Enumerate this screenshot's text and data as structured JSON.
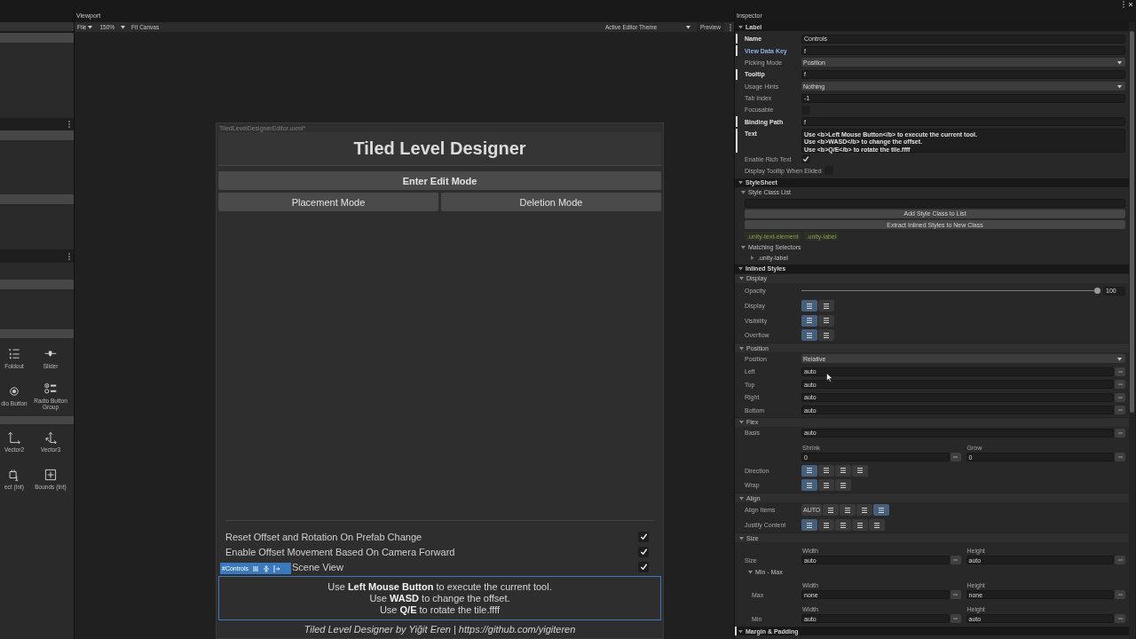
{
  "left_panel": {
    "library_items": [
      {
        "label": "Foldout"
      },
      {
        "label": "Slider"
      },
      {
        "label": "dio Button"
      },
      {
        "label": "Radio Button Group"
      },
      {
        "label": "Vector2"
      },
      {
        "label": "Vector3"
      },
      {
        "label": "ect (Int)"
      },
      {
        "label": "Bounds (Int)"
      }
    ]
  },
  "viewport": {
    "title": "Viewport",
    "toolbar": {
      "file_menu": "File",
      "zoom": "150%",
      "fit_button": "Fit Canvas",
      "theme": "Active Editor Theme",
      "preview_button": "Preview"
    },
    "document": {
      "file_name": "TiledLevelDesignerEditor.uxml*",
      "title": "Tiled Level Designer",
      "primary_button": "Enter Edit Mode",
      "mode_buttons": [
        {
          "label": "Placement Mode"
        },
        {
          "label": "Deletion Mode"
        }
      ],
      "toggles": [
        {
          "label": "Reset Offset and Rotation On Prefab Change",
          "checked": true
        },
        {
          "label": "Enable Offset Movement Based On Camera Forward",
          "checked": true
        },
        {
          "label": "Scene View",
          "checked": true
        }
      ],
      "controls": {
        "selected": true,
        "tag": "#Controls",
        "lines": [
          "Use **Left Mouse Button** to execute the current tool.",
          "Use **WASD** to change the offset.",
          "Use **Q/E** to rotate the tile.ffff"
        ]
      },
      "footer": "Tiled Level Designer by Yiğit Eren | https://github.com/yigiteren"
    }
  },
  "inspector": {
    "title": "Inspector",
    "sections": [
      {
        "title": "Label",
        "expanded": true,
        "overridden": false,
        "rows": [
          {
            "kind": "field",
            "label": "Name",
            "value": "Controls",
            "overridden": true,
            "focused": false
          },
          {
            "kind": "field",
            "label": "View Data Key",
            "value": "f",
            "overridden": true,
            "focused": true
          },
          {
            "kind": "dropdown",
            "label": "Picking Mode",
            "value": "Position",
            "overridden": false,
            "focused": false
          },
          {
            "kind": "field",
            "label": "Tooltip",
            "value": "f",
            "overridden": true,
            "focused": false
          },
          {
            "kind": "dropdown",
            "label": "Usage Hints",
            "value": "Nothing",
            "overridden": false,
            "focused": false
          },
          {
            "kind": "field",
            "label": "Tab Index",
            "value": "-1",
            "overridden": false,
            "focused": false
          },
          {
            "kind": "checkbox",
            "label": "Focusable",
            "checked": false,
            "overridden": false,
            "focused": false
          },
          {
            "kind": "field",
            "label": "Binding Path",
            "value": "f",
            "overridden": true,
            "focused": false
          },
          {
            "kind": "textarea",
            "label": "Text",
            "lines": [
              "Use <b>Left Mouse Button</b> to execute the current tool.",
              "Use <b>WASD</b> to change the offset.",
              "Use <b>Q/E</b> to rotate the tile.ffff"
            ],
            "overridden": true,
            "focused": false
          },
          {
            "kind": "checkbox",
            "label": "Enable Rich Text",
            "checked": true,
            "overridden": false,
            "focused": false
          },
          {
            "kind": "checkbox",
            "label": "Display Tooltip When Elided",
            "checked": false,
            "overridden": false,
            "focused": false
          }
        ]
      },
      {
        "title": "StyleSheet",
        "expanded": true,
        "overridden": false,
        "subsections": [
          {
            "kind": "foldout",
            "title": "Style Class List",
            "expanded": true,
            "rows": [
              {
                "kind": "input"
              },
              {
                "kind": "button",
                "label": "Add Style Class to List"
              },
              {
                "kind": "button",
                "label": "Extract Inlined Styles to New Class"
              },
              {
                "kind": "tags",
                "tags": [
                  {
                    "label": ".unity-text-element"
                  },
                  {
                    "label": ".unity-label"
                  }
                ]
              }
            ]
          },
          {
            "kind": "foldout",
            "title": "Matching Selectors",
            "expanded": true,
            "rows": [
              {
                "kind": "tree-item",
                "label": ".unity-label",
                "expanded": false
              }
            ]
          }
        ]
      },
      {
        "title": "Inlined Styles",
        "expanded": true,
        "overridden": false,
        "subsections": [
          {
            "kind": "bar",
            "title": "Display",
            "expanded": true,
            "rows": [
              {
                "kind": "slider",
                "label": "Opacity",
                "level": 1,
                "reading": "100"
              },
              {
                "kind": "toggles",
                "label": "Display",
                "options": [
                  {
                    "selected": true
                  },
                  {
                    "selected": false
                  }
                ]
              },
              {
                "kind": "toggles",
                "label": "Visibility",
                "options": [
                  {
                    "selected": true
                  },
                  {
                    "selected": false
                  }
                ]
              },
              {
                "kind": "toggles",
                "label": "Overflow",
                "options": [
                  {
                    "selected": true
                  },
                  {
                    "selected": false
                  }
                ]
              }
            ]
          },
          {
            "kind": "bar",
            "title": "Position",
            "expanded": true,
            "rows": [
              {
                "kind": "dropdown",
                "label": "Position",
                "value": "Relative"
              },
              {
                "kind": "unit-field",
                "label": "Left",
                "value": "auto"
              },
              {
                "kind": "unit-field",
                "label": "Top",
                "value": "auto"
              },
              {
                "kind": "unit-field",
                "label": "Right",
                "value": "auto"
              },
              {
                "kind": "unit-field",
                "label": "Bottom",
                "value": "auto"
              }
            ]
          },
          {
            "kind": "bar",
            "title": "Flex",
            "expanded": true,
            "rows": [
              {
                "kind": "unit-field",
                "label": "Basis",
                "value": "auto"
              },
              {
                "kind": "pair",
                "items": [
                  {
                    "heading": "Shrink",
                    "value": "0"
                  },
                  {
                    "heading": "Grow",
                    "value": "0"
                  }
                ]
              },
              {
                "kind": "toggles",
                "label": "Direction",
                "options": [
                  {
                    "selected": true
                  },
                  {
                    "selected": false
                  },
                  {
                    "selected": false
                  },
                  {
                    "selected": false
                  }
                ]
              },
              {
                "kind": "toggles",
                "label": "Wrap",
                "options": [
                  {
                    "selected": true
                  },
                  {
                    "selected": false
                  },
                  {
                    "selected": false
                  }
                ]
              }
            ]
          },
          {
            "kind": "bar",
            "title": "Align",
            "expanded": true,
            "rows": [
              {
                "kind": "toggles",
                "label": "Align Items",
                "options": [
                  {
                    "text": "AUTO",
                    "selected": false
                  },
                  {
                    "selected": false
                  },
                  {
                    "selected": false
                  },
                  {
                    "selected": false
                  },
                  {
                    "selected": true
                  }
                ]
              },
              {
                "kind": "toggles",
                "label": "Justify Content",
                "options": [
                  {
                    "selected": true
                  },
                  {
                    "selected": false
                  },
                  {
                    "selected": false
                  },
                  {
                    "selected": false
                  },
                  {
                    "selected": false
                  }
                ]
              }
            ]
          },
          {
            "kind": "bar",
            "title": "Size",
            "expanded": true,
            "rows": [
              {
                "kind": "pair",
                "label": "Size",
                "items": [
                  {
                    "heading": "Width",
                    "value": "auto"
                  },
                  {
                    "heading": "Height",
                    "value": "auto"
                  }
                ]
              },
              {
                "kind": "foldout",
                "title": "Min - Max",
                "expanded": true,
                "children": [
                  {
                    "kind": "pair",
                    "label": "Max",
                    "items": [
                      {
                        "heading": "Width",
                        "value": "none"
                      },
                      {
                        "heading": "Height",
                        "value": "none"
                      }
                    ]
                  },
                  {
                    "kind": "pair",
                    "label": "Min",
                    "items": [
                      {
                        "heading": "Width",
                        "value": "auto"
                      },
                      {
                        "heading": "Height",
                        "value": "auto"
                      }
                    ]
                  }
                ]
              }
            ]
          }
        ]
      },
      {
        "title": "Margin & Padding",
        "expanded": true,
        "overridden": true
      }
    ]
  }
}
